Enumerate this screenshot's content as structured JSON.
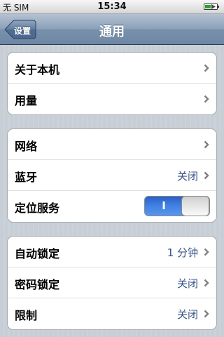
{
  "status_bar": {
    "carrier": "无 SIM",
    "time": "15:34",
    "battery_level": 0.45
  },
  "nav": {
    "back_label": "设置",
    "title": "通用"
  },
  "groups": [
    {
      "rows": [
        {
          "label": "关于本机"
        },
        {
          "label": "用量"
        }
      ]
    },
    {
      "rows": [
        {
          "label": "网络"
        },
        {
          "label": "蓝牙",
          "value": "关闭"
        },
        {
          "label": "定位服务",
          "toggle_text": "I",
          "toggle_state": "on"
        }
      ]
    },
    {
      "rows": [
        {
          "label": "自动锁定",
          "value": "1 分钟"
        },
        {
          "label": "密码锁定",
          "value": "关闭"
        },
        {
          "label": "限制",
          "value": "关闭"
        }
      ]
    }
  ],
  "colors": {
    "value_text": "#385487",
    "toggle_on": "#4182e4",
    "nav_bar": "#7890ab",
    "background": "#c5ccd4"
  },
  "icons": {
    "row_disclosure": "chevron-right-icon",
    "battery": "battery-charging-icon"
  }
}
